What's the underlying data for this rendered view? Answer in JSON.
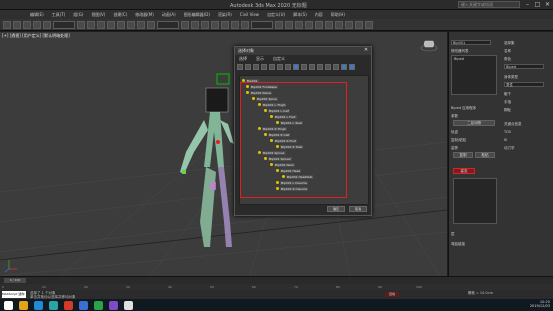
{
  "window": {
    "title": "Autodesk 3ds Max 2020 无标题",
    "search_placeholder": "键入关键字或短语",
    "controls": [
      "–",
      "□",
      "✕"
    ]
  },
  "menubar": [
    "编辑(E)",
    "工具(T)",
    "组(G)",
    "视图(V)",
    "创建(C)",
    "修改器(M)",
    "动画(A)",
    "图形编辑器(D)",
    "渲染(R)",
    "Civil View",
    "自定义(U)",
    "脚本(S)",
    "内容",
    "帮助(H)"
  ],
  "viewport": {
    "label": "[+] [透视] [用户定义] [默认明暗处理]"
  },
  "dialog": {
    "title": "选择对象",
    "close": "✕",
    "menu": [
      "选择",
      "显示",
      "自定义"
    ],
    "tree": [
      {
        "depth": 0,
        "label": "Bip001"
      },
      {
        "depth": 1,
        "label": "Bip001 Footsteps"
      },
      {
        "depth": 1,
        "label": "Bip001 Pelvis"
      },
      {
        "depth": 2,
        "label": "Bip001 Spine"
      },
      {
        "depth": 3,
        "label": "Bip001 L Thigh"
      },
      {
        "depth": 4,
        "label": "Bip001 L Calf"
      },
      {
        "depth": 5,
        "label": "Bip001 L Foot"
      },
      {
        "depth": 6,
        "label": "Bip001 L Toe0"
      },
      {
        "depth": 3,
        "label": "Bip001 R Thigh"
      },
      {
        "depth": 4,
        "label": "Bip001 R Calf"
      },
      {
        "depth": 5,
        "label": "Bip001 R Foot"
      },
      {
        "depth": 6,
        "label": "Bip001 R Toe0"
      },
      {
        "depth": 3,
        "label": "Bip001 Spine1"
      },
      {
        "depth": 4,
        "label": "Bip001 Spine2"
      },
      {
        "depth": 5,
        "label": "Bip001 Neck"
      },
      {
        "depth": 6,
        "label": "Bip001 Head"
      },
      {
        "depth": 7,
        "label": "Bip001 HeadNub"
      },
      {
        "depth": 6,
        "label": "Bip001 L Clavicle"
      },
      {
        "depth": 6,
        "label": "Bip001 R Clavicle"
      }
    ],
    "ok_label": "确定",
    "cancel_label": "取消"
  },
  "command_panel": {
    "left_labels": [
      "Bip001",
      "修改器列表",
      "Biped",
      "Biped 应用程序",
      "参数",
      "二足动物",
      "轨迹",
      "复制/粘贴",
      "姿势",
      "复制",
      "粘贴",
      "层",
      "弯曲链接"
    ],
    "right_labels": [
      "选择集",
      "名称",
      "角色",
      "Biped",
      "身体类型",
      "男性",
      "躯干",
      "手指",
      "脚趾",
      "关键点信息",
      "TCB",
      "IK",
      "动力学"
    ],
    "highlight_button": "姿态"
  },
  "timeline": {
    "frame": "0 / 100",
    "ticks": [
      "0",
      "10",
      "20",
      "30",
      "40",
      "50",
      "60",
      "70",
      "80",
      "90",
      "100"
    ]
  },
  "status": {
    "script_label": "MAXScript 迷你",
    "message": "选择了 1 个对象",
    "hint": "单击并拖动以选择并移动对象",
    "grid": "栅格 = 10.0cm",
    "autokey": "自动"
  },
  "taskbar": {
    "time": "10:25",
    "date": "2019/12/03"
  },
  "colors": {
    "highlight": "#e02020",
    "bone": "#e0c400",
    "selection": "#3f79c4"
  }
}
